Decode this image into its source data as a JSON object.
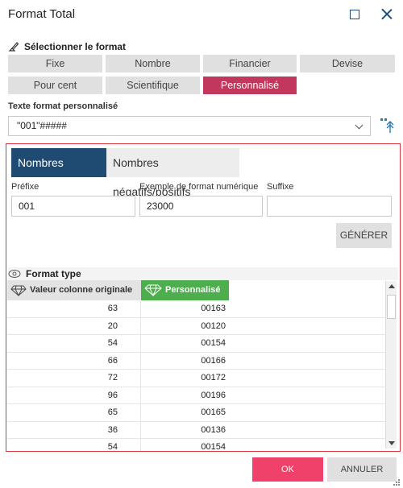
{
  "window": {
    "title": "Format Total"
  },
  "format_section": {
    "heading": "Sélectionner le format",
    "buttons": [
      {
        "label": "Fixe",
        "active": false
      },
      {
        "label": "Nombre",
        "active": false
      },
      {
        "label": "Financier",
        "active": false
      },
      {
        "label": "Devise",
        "active": false
      },
      {
        "label": "Pour cent",
        "active": false
      },
      {
        "label": "Scientifique",
        "active": false
      },
      {
        "label": "Personnalisé",
        "active": true
      }
    ]
  },
  "custom_format": {
    "label": "Texte format personnalisé",
    "value": "\"001\"#####"
  },
  "tabs": [
    {
      "label": "Nombres simples",
      "active": true
    },
    {
      "label": "Nombres négatifs/positifs",
      "active": false
    }
  ],
  "fields": {
    "prefix_label": "Préfixe",
    "prefix_value": "001",
    "example_label": "Exemple de format numérique",
    "example_value": "23000",
    "suffix_label": "Suffixe",
    "suffix_value": ""
  },
  "generate_button": "GÉNÉRER",
  "format_type": {
    "heading": "Format type",
    "columns": [
      "Valeur colonne originale",
      "Personnalisé"
    ],
    "rows": [
      [
        "63",
        "00163"
      ],
      [
        "20",
        "00120"
      ],
      [
        "54",
        "00154"
      ],
      [
        "66",
        "00166"
      ],
      [
        "72",
        "00172"
      ],
      [
        "96",
        "00196"
      ],
      [
        "65",
        "00165"
      ],
      [
        "36",
        "00136"
      ],
      [
        "54",
        "00154"
      ]
    ]
  },
  "footer": {
    "ok": "OK",
    "cancel": "ANNULER"
  },
  "colors": {
    "active_format": "#c2385c",
    "active_tab": "#1f4b73",
    "custom_column": "#4cae4c",
    "panel_border": "#d9353e",
    "ok_button": "#f0416a"
  }
}
